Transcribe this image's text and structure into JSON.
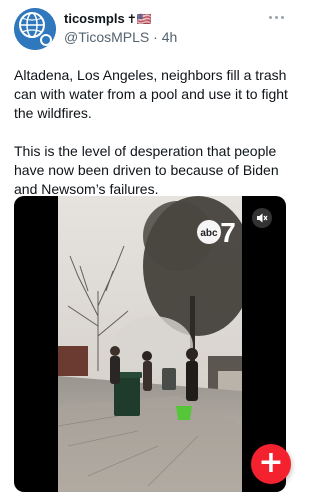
{
  "author": {
    "display_name": "ticosmpls",
    "badge": "✝🇺🇸",
    "handle": "@TicosMPLS",
    "separator": "·",
    "time": "4h"
  },
  "post": {
    "paragraph_1": "Altadena, Los Angeles, neighbors fill a trash can with water from a pool and use it to fight the wildfires.",
    "paragraph_2": "This is the level of desperation that people have now been driven to because of Biden and Newsom’s failures."
  },
  "media": {
    "type": "video",
    "muted": true,
    "watermark_text": "abc",
    "watermark_number": "7",
    "mute_icon": "speaker-muted-icon"
  },
  "fab": {
    "icon": "plus-icon",
    "label": "+",
    "color": "#f4212e"
  },
  "colors": {
    "text_primary": "#0f1419",
    "text_secondary": "#536471",
    "avatar_blue": "#2c6fb0"
  }
}
